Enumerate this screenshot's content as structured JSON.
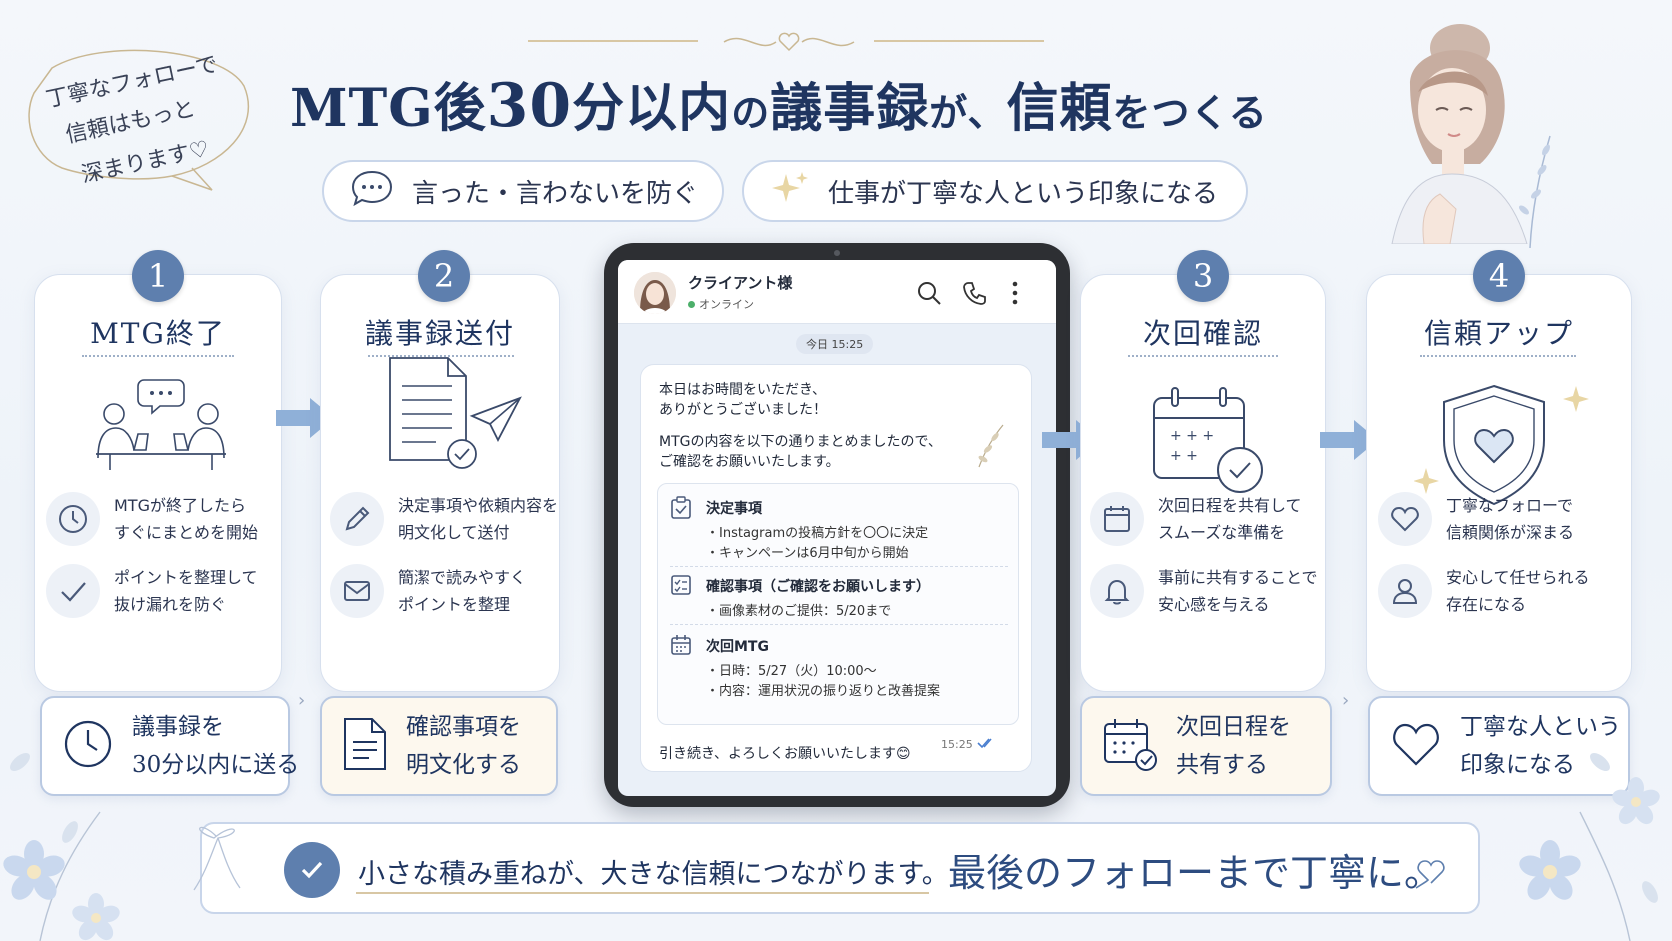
{
  "note": {
    "lines": [
      "丁寧なフォローで",
      "信頼はもっと",
      "深まります♡"
    ]
  },
  "title": {
    "part1": "MTG後",
    "part2": "30",
    "part3": "分以内",
    "part4": "の",
    "part5": "議事録",
    "part6": "が、",
    "part7": "信頼",
    "part8": "をつくる"
  },
  "pills": [
    {
      "icon": "speech-bubble-icon",
      "label": "言った・言わないを防ぐ"
    },
    {
      "icon": "sparkle-icon",
      "label": "仕事が丁寧な人という印象になる"
    }
  ],
  "steps": [
    {
      "number": "1",
      "title": "MTG終了",
      "features": [
        {
          "icon": "clock-icon",
          "line1": "MTGが終了したら",
          "line2": "すぐにまとめを開始"
        },
        {
          "icon": "check-icon",
          "line1": "ポイントを整理して",
          "line2": "抜け漏れを防ぐ"
        }
      ],
      "action": {
        "icon": "clock-icon",
        "line1": "議事録を",
        "line2": "30分以内に送る"
      }
    },
    {
      "number": "2",
      "title": "議事録送付",
      "features": [
        {
          "icon": "pencil-icon",
          "line1": "決定事項や依頼内容を",
          "line2": "明文化して送付"
        },
        {
          "icon": "mail-icon",
          "line1": "簡潔で読みやすく",
          "line2": "ポイントを整理"
        }
      ],
      "action": {
        "icon": "document-icon",
        "line1": "確認事項を",
        "line2": "明文化する"
      }
    },
    {
      "number": "3",
      "title": "次回確認",
      "features": [
        {
          "icon": "calendar-icon",
          "line1": "次回日程を共有して",
          "line2": "スムーズな準備を"
        },
        {
          "icon": "bell-icon",
          "line1": "事前に共有することで",
          "line2": "安心感を与える"
        }
      ],
      "action": {
        "icon": "calendar-check-icon",
        "line1": "次回日程を",
        "line2": "共有する"
      }
    },
    {
      "number": "4",
      "title": "信頼アップ",
      "features": [
        {
          "icon": "heart-icon",
          "line1": "丁寧なフォローで",
          "line2": "信頼関係が深まる"
        },
        {
          "icon": "user-icon",
          "line1": "安心して任せられる",
          "line2": "存在になる"
        }
      ],
      "action": {
        "icon": "heart-icon",
        "line1": "丁寧な人という",
        "line2": "印象になる"
      }
    }
  ],
  "chat": {
    "contact_name": "クライアント様",
    "status": "オンライン",
    "date_chip": "今日 15:25",
    "greeting1": "本日はお時間をいただき、",
    "greeting2": "ありがとうございました！",
    "intro1": "MTGの内容を以下の通りまとめましたので、",
    "intro2": "ご確認をお願いいたします。",
    "sections": [
      {
        "icon": "clipboard-check-icon",
        "heading": "決定事項",
        "items": [
          "・Instagramの投稿方針を〇〇に決定",
          "・キャンペーンは6月中旬から開始"
        ]
      },
      {
        "icon": "checklist-icon",
        "heading": "確認事項（ご確認をお願いします）",
        "items": [
          "・画像素材のご提供：5/20まで"
        ]
      },
      {
        "icon": "calendar-icon",
        "heading": "次回MTG",
        "items": [
          "・日時：5/27（火）10:00〜",
          "・内容：運用状況の振り返りと改善提案"
        ]
      }
    ],
    "closing": "引き続き、よろしくお願いいたします😊",
    "time": "15:25"
  },
  "banner": {
    "text1": "小さな積み重ねが、大きな信頼につながります。",
    "text2": "最後のフォローまで丁寧に。"
  },
  "colors": {
    "navy": "#1f3560",
    "accent_blue": "#5e7fae",
    "gold": "#d8c7a4",
    "arrow": "#8fb0d8"
  }
}
